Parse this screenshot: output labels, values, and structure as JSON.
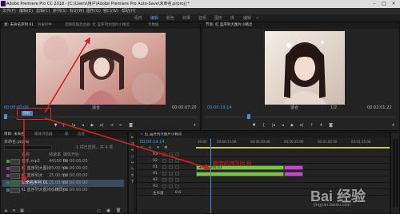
{
  "window": {
    "title": "Adobe Premiere Pro CC 2018 - [C:\\Users\\用户\\Adobe Premiere Pro Auto-Save\\未命名.prproj] *",
    "minimize_icon": "minimize-icon",
    "maximize_icon": "maximize-icon",
    "close_icon": "close-icon"
  },
  "menu": [
    "文件(F)",
    "编辑(E)",
    "剪辑(C)",
    "序列(S)",
    "标记(M)",
    "图形(G)",
    "窗口(W)",
    "帮助(H)"
  ],
  "workspaces": {
    "items": [
      "组件",
      "编辑",
      "颜色",
      "效果",
      "音频",
      "图形",
      "库",
      "编辑"
    ],
    "active_index": 1
  },
  "source_monitor": {
    "tabs": [
      "源: 未命名序列 01",
      "效果控件",
      "音频剪辑混合器: 红  蓝序列大图片小精灵",
      "元数据"
    ],
    "active_tab": 0,
    "timecode_left": "00:00:00:00",
    "fit": "适合",
    "timecode_right": "00:00:07:20",
    "overlay_label": "序列"
  },
  "program_monitor": {
    "tab": "节目: 红  蓝序列大图片小精灵",
    "timecode_left": "00:00:19:14",
    "fit": "适合",
    "timecode_right": "00:02:01:22",
    "zoom": "1/2"
  },
  "project": {
    "tabs": [
      "项目: 未命名",
      "媒体浏览器",
      "库",
      "信息"
    ],
    "active_tab": 0,
    "file_name": "未命名.prproj",
    "selection": "1 项已选择，共 4 项",
    "columns": [
      "名称",
      "帧速率",
      "媒体开始"
    ],
    "items": [
      {
        "name": "音乐.mp3",
        "fps": "44100 Hz",
        "start": "00:00:00:00",
        "color": "#4a9b3c"
      },
      {
        "name": "红 蓝序列大图片",
        "fps": "25.00 fps",
        "start": "00:00:00:00",
        "color": "#8e3fa4"
      },
      {
        "name": "红 蓝序列大",
        "fps": "25.00 fps",
        "start": "00:00:00:00",
        "color": "#8e3fa4"
      },
      {
        "name": "未命名序列 01",
        "fps": "25.00 fps",
        "start": "00:00:00:00",
        "color": "#2f7d3a"
      },
      {
        "name": "红 蓝序列大图片小精灵",
        "fps": "25.00 fps",
        "start": "00:00:00:00",
        "color": "#3a6fa0"
      }
    ]
  },
  "timeline": {
    "tab": "红  蓝序列大图片小精灵",
    "timecode": "00:00:19:14",
    "ruler": [
      "00:00",
      "00:00:15:00",
      "00:00:30:00",
      "00:00:45:00",
      "00:01:00:00",
      "00:01:15:00"
    ],
    "tracks": [
      "V3",
      "V2",
      "V1",
      "A1",
      "A2",
      "A3",
      "主声道"
    ],
    "master_value": "0.0",
    "clips": [
      {
        "track": "V1",
        "label": "未命名序列 01",
        "color": "#7ac447"
      },
      {
        "track": "V1b",
        "label": "",
        "color": "#c04ec6"
      },
      {
        "track": "A1",
        "label": "",
        "color": "#7ac447"
      },
      {
        "track": "A1b",
        "label": "",
        "color": "#c04ec6"
      }
    ]
  },
  "annotation": {
    "text": "嵌套的序列片段",
    "color": "#d62020"
  },
  "watermark": {
    "text": "Bai 经验",
    "sub": "jingyan.baidu.com"
  }
}
